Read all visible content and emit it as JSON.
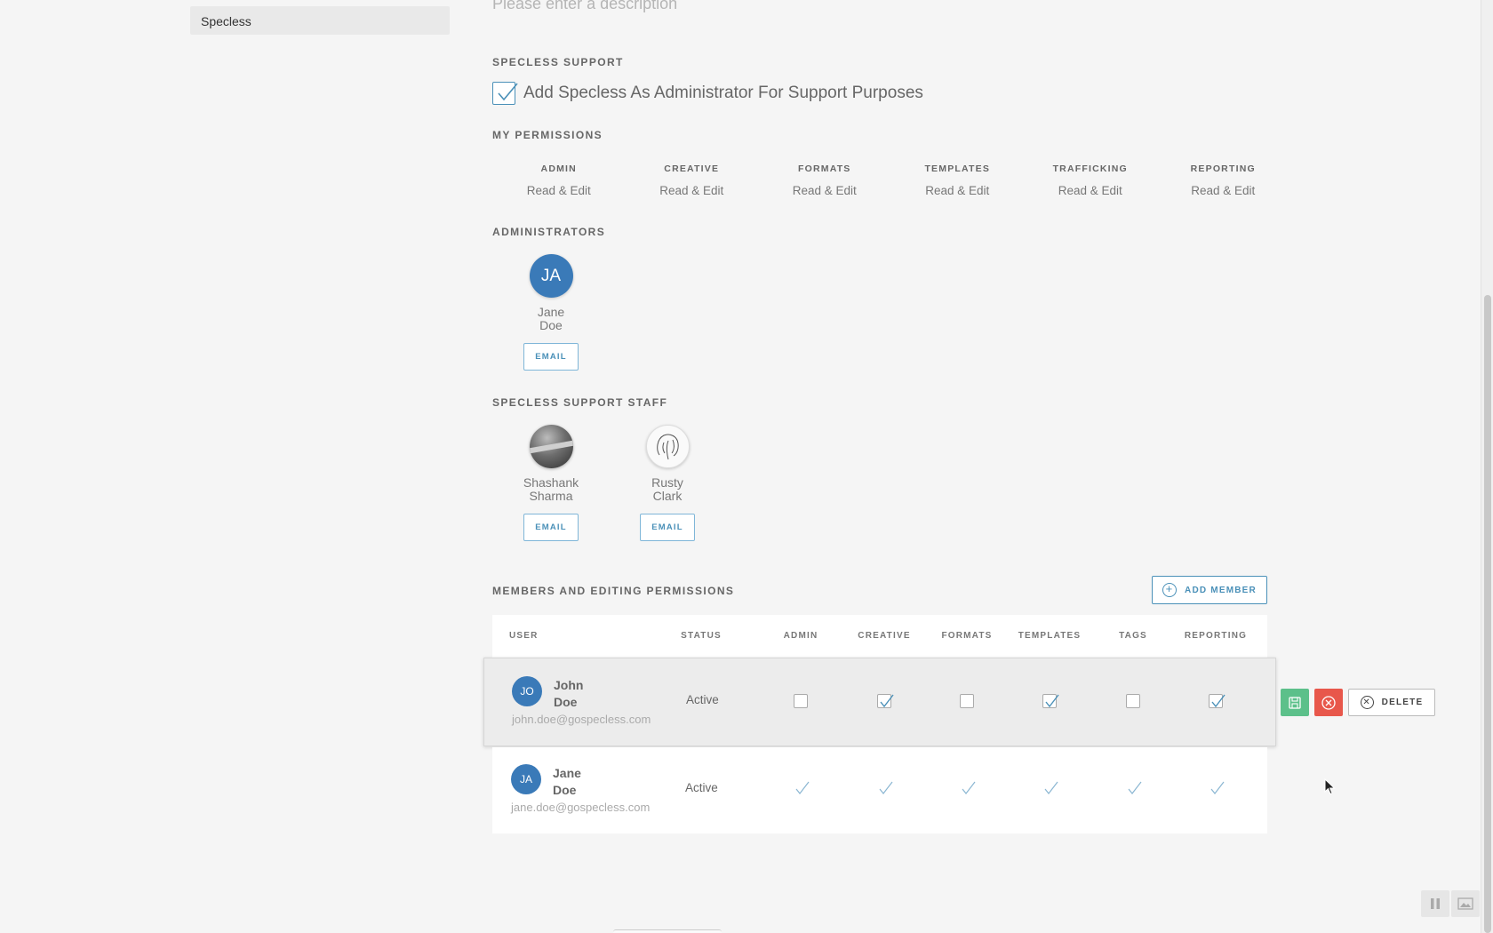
{
  "sidebar": {
    "selected_item": "Specless"
  },
  "description": {
    "placeholder": "Please enter a description"
  },
  "support": {
    "title": "SPECLESS SUPPORT",
    "checkbox_label": "Add Specless As Administrator For Support Purposes",
    "checked": true
  },
  "my_permissions": {
    "title": "MY PERMISSIONS",
    "items": [
      {
        "label": "ADMIN",
        "value": "Read & Edit"
      },
      {
        "label": "CREATIVE",
        "value": "Read & Edit"
      },
      {
        "label": "FORMATS",
        "value": "Read & Edit"
      },
      {
        "label": "TEMPLATES",
        "value": "Read & Edit"
      },
      {
        "label": "TRAFFICKING",
        "value": "Read & Edit"
      },
      {
        "label": "REPORTING",
        "value": "Read & Edit"
      }
    ]
  },
  "administrators": {
    "title": "ADMINISTRATORS",
    "people": [
      {
        "initials": "JA",
        "first": "Jane",
        "last": "Doe",
        "email_label": "EMAIL"
      }
    ]
  },
  "support_staff": {
    "title": "SPECLESS SUPPORT STAFF",
    "people": [
      {
        "first": "Shashank",
        "last": "Sharma",
        "email_label": "EMAIL",
        "avatar": "photo"
      },
      {
        "first": "Rusty",
        "last": "Clark",
        "email_label": "EMAIL",
        "avatar": "elephant-sketch"
      }
    ]
  },
  "members": {
    "title": "MEMBERS AND EDITING PERMISSIONS",
    "add_label": "ADD MEMBER",
    "columns": [
      "USER",
      "STATUS",
      "ADMIN",
      "CREATIVE",
      "FORMATS",
      "TEMPLATES",
      "TAGS",
      "REPORTING"
    ],
    "rows": [
      {
        "initials": "JO",
        "first": "John",
        "last": "Doe",
        "email": "john.doe@gospecless.com",
        "status": "Active",
        "permissions": [
          false,
          true,
          false,
          true,
          false,
          true
        ],
        "editing": true
      },
      {
        "initials": "JA",
        "first": "Jane",
        "last": "Doe",
        "email": "jane.doe@gospecless.com",
        "status": "Active",
        "permissions": [
          true,
          true,
          true,
          true,
          true,
          true
        ],
        "editing": false
      }
    ],
    "actions": {
      "delete_label": "DELETE"
    }
  },
  "colors": {
    "accent": "#4a90b8",
    "avatar": "#3a7ab8",
    "save": "#5cc08a",
    "cancel": "#e8574b"
  }
}
